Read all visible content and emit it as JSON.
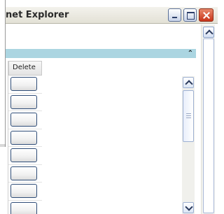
{
  "window": {
    "title": "net Explorer",
    "buttons": {
      "minimize": "minimize-icon",
      "maximize": "maximize-icon",
      "close": "close-icon"
    }
  },
  "panel": {
    "collapse_icon": "double-chevron-up-icon",
    "collapse_glyph": "⌃"
  },
  "grid": {
    "columns": [
      "Delete"
    ],
    "rows": [
      {
        "button": "delete"
      },
      {
        "button": "delete"
      },
      {
        "button": "delete"
      },
      {
        "button": "delete"
      },
      {
        "button": "delete"
      },
      {
        "button": "delete"
      },
      {
        "button": "delete"
      },
      {
        "button": "delete"
      }
    ]
  },
  "colors": {
    "panel_header": "#abd5e1",
    "close_button": "#c8351a",
    "button_border": "#2f4d78"
  }
}
